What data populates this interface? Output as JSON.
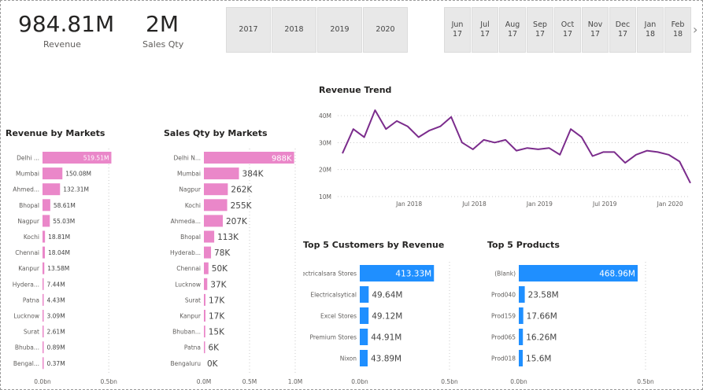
{
  "kpis": {
    "revenue": {
      "value": "984.81M",
      "label": "Revenue"
    },
    "sales_qty": {
      "value": "2M",
      "label": "Sales Qty"
    }
  },
  "year_slicer": [
    "2017",
    "2018",
    "2019",
    "2020"
  ],
  "month_slicer": [
    {
      "m": "Jun",
      "y": "17"
    },
    {
      "m": "Jul",
      "y": "17"
    },
    {
      "m": "Aug",
      "y": "17"
    },
    {
      "m": "Sep",
      "y": "17"
    },
    {
      "m": "Oct",
      "y": "17"
    },
    {
      "m": "Nov",
      "y": "17"
    },
    {
      "m": "Dec",
      "y": "17"
    },
    {
      "m": "Jan",
      "y": "18"
    },
    {
      "m": "Feb",
      "y": "18"
    }
  ],
  "colors": {
    "pink": "#ea87c9",
    "blue": "#1f8fff",
    "purple": "#7b2c8c",
    "grid": "#c8c8c8"
  },
  "chart_data": [
    {
      "id": "revenue_by_markets",
      "type": "bar",
      "title": "Revenue by Markets",
      "categories": [
        "Delhi ...",
        "Mumbai",
        "Ahmed...",
        "Bhopal",
        "Nagpur",
        "Kochi",
        "Chennai",
        "Kanpur",
        "Hydera...",
        "Patna",
        "Lucknow",
        "Surat",
        "Bhuba...",
        "Bengal..."
      ],
      "values": [
        519.51,
        150.08,
        132.31,
        58.61,
        55.03,
        18.81,
        18.04,
        13.58,
        7.44,
        4.43,
        3.09,
        2.61,
        0.89,
        0.37
      ],
      "labels": [
        "519.51M",
        "150.08M",
        "132.31M",
        "58.61M",
        "55.03M",
        "18.81M",
        "18.04M",
        "13.58M",
        "7.44M",
        "4.43M",
        "3.09M",
        "2.61M",
        "0.89M",
        "0.37M"
      ],
      "xticks": [
        "0.0bn",
        "0.5bn"
      ],
      "xlim": [
        0,
        600
      ],
      "tick_values": [
        0,
        500
      ]
    },
    {
      "id": "sales_qty_by_markets",
      "type": "bar",
      "title": "Sales Qty by Markets",
      "categories": [
        "Delhi N...",
        "Mumbai",
        "Nagpur",
        "Kochi",
        "Ahmeda...",
        "Bhopal",
        "Hyderab...",
        "Chennai",
        "Lucknow",
        "Surat",
        "Kanpur",
        "Bhuban...",
        "Patna",
        "Bengaluru"
      ],
      "values": [
        988,
        384,
        262,
        255,
        207,
        113,
        78,
        50,
        37,
        17,
        17,
        15,
        6,
        0
      ],
      "labels": [
        "988K",
        "384K",
        "262K",
        "255K",
        "207K",
        "113K",
        "78K",
        "50K",
        "37K",
        "17K",
        "17K",
        "15K",
        "6K",
        "0K"
      ],
      "xticks": [
        "0.0M",
        "0.5M",
        "1.0M"
      ],
      "xlim": [
        0,
        1000
      ],
      "tick_values": [
        0,
        500,
        1000
      ]
    },
    {
      "id": "revenue_trend",
      "type": "line",
      "title": "Revenue Trend",
      "yticks": [
        "10M",
        "20M",
        "30M",
        "40M"
      ],
      "ylim": [
        10,
        40
      ],
      "xticks": [
        "Jan 2018",
        "Jul 2018",
        "Jan 2019",
        "Jul 2019",
        "Jan 2020"
      ],
      "xtick_index": [
        7,
        13,
        19,
        25,
        31
      ],
      "values": [
        26,
        35,
        32,
        42,
        35,
        38,
        36,
        32,
        34.5,
        36,
        39.5,
        30,
        27.5,
        31,
        30,
        31,
        27,
        28,
        27.5,
        28,
        25.5,
        35,
        32,
        25,
        26.5,
        26.5,
        22.5,
        25.5,
        27,
        26.5,
        25.5,
        23,
        15
      ]
    },
    {
      "id": "top5_customers",
      "type": "bar",
      "title": "Top 5 Customers by Revenue",
      "categories": [
        "Electricalsara Stores",
        "Electricalsytical",
        "Excel Stores",
        "Premium Stores",
        "Nixon"
      ],
      "values": [
        413.33,
        49.64,
        49.12,
        44.91,
        43.89
      ],
      "labels": [
        "413.33M",
        "49.64M",
        "49.12M",
        "44.91M",
        "43.89M"
      ],
      "xticks": [
        "0.0bn",
        "0.5bn"
      ],
      "xlim": [
        0,
        500
      ],
      "tick_values": [
        0,
        500
      ]
    },
    {
      "id": "top5_products",
      "type": "bar",
      "title": "Top 5 Products",
      "categories": [
        "(Blank)",
        "Prod040",
        "Prod159",
        "Prod065",
        "Prod018"
      ],
      "values": [
        468.96,
        23.58,
        17.66,
        16.26,
        15.6
      ],
      "labels": [
        "468.96M",
        "23.58M",
        "17.66M",
        "16.26M",
        "15.6M"
      ],
      "xticks": [
        "0.0bn",
        "0.5bn"
      ],
      "xlim": [
        0,
        500
      ],
      "tick_values": [
        0,
        500
      ]
    }
  ]
}
